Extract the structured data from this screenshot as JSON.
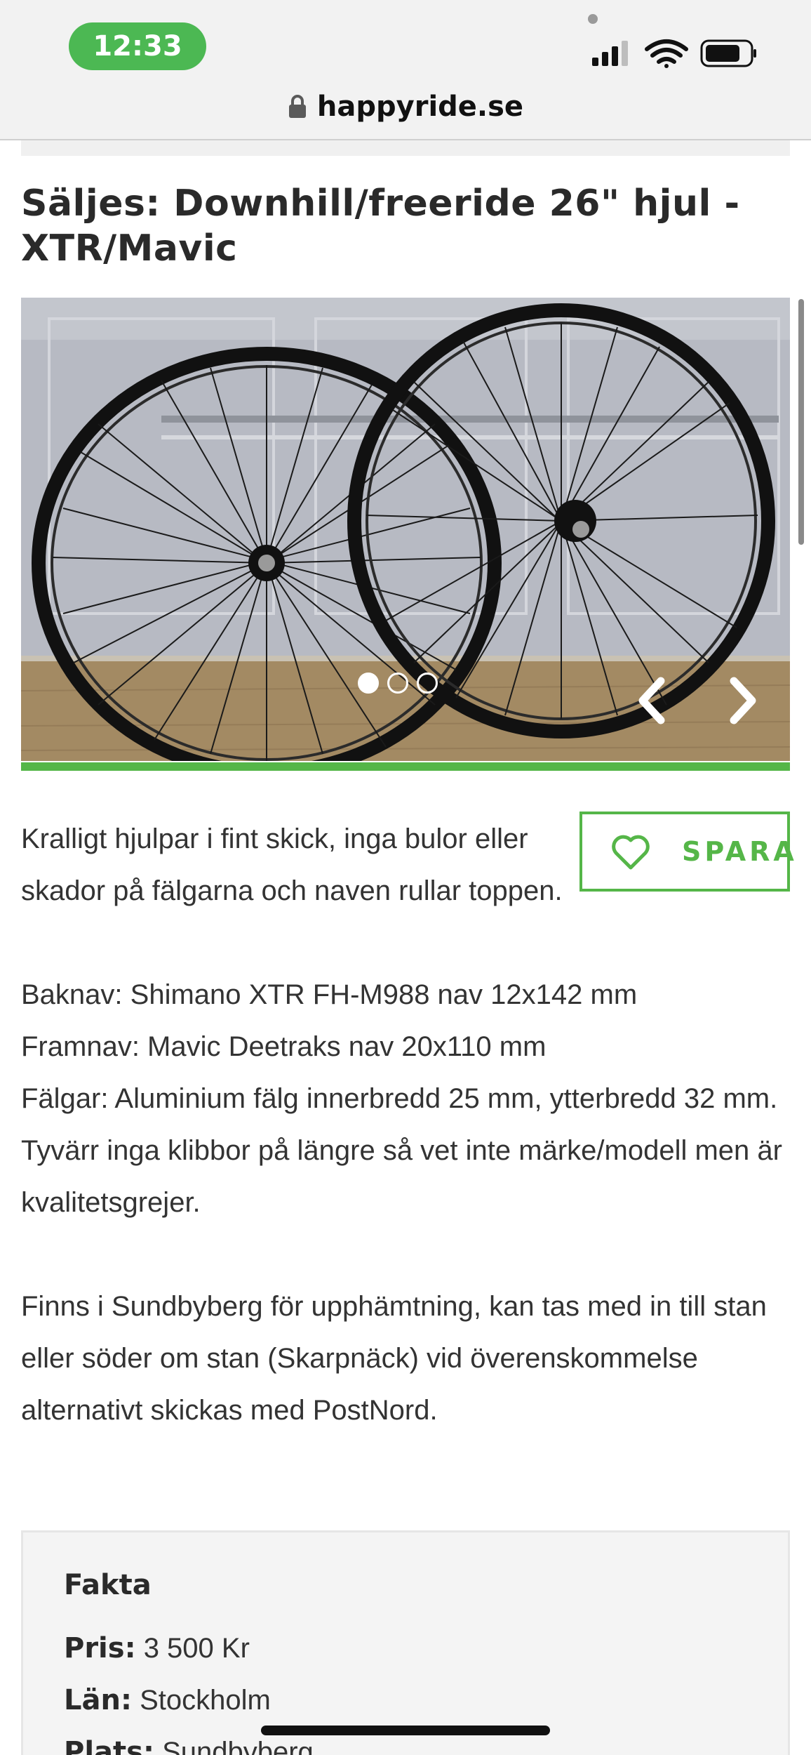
{
  "status_bar": {
    "time": "12:33",
    "icons": [
      "signal-icon",
      "wifi-icon",
      "battery-icon"
    ]
  },
  "browser": {
    "url": "happyride.se",
    "lock_icon": "lock-icon"
  },
  "listing": {
    "title": "Säljes: Downhill/freeride 26\" hjul - XTR/Mavic",
    "gallery": {
      "image_description_icon": "bicycle-wheels-photo",
      "total_images": 3,
      "active_index": 0
    },
    "save_button": {
      "label": "SPARA",
      "icon": "heart-icon",
      "accent": "#55b648"
    },
    "description": {
      "p1": "Kralligt hjulpar i fint skick, inga bulor eller skador på fälgarna och naven rullar toppen.",
      "p2_line1": "Baknav: Shimano XTR FH-M988 nav 12x142 mm",
      "p2_line2": "Framnav: Mavic Deetraks nav 20x110 mm",
      "p2_line3": "Fälgar: Aluminium fälg innerbredd 25 mm, ytterbredd 32 mm. Tyvärr inga klibbor på längre så vet inte märke/modell men är kvalitetsgrejer.",
      "p3": "Finns i Sundbyberg för upphämtning, kan tas med in till stan eller söder om stan (Skarpnäck) vid överenskommelse alternativt skickas med PostNord."
    },
    "facts": {
      "title": "Fakta",
      "price_label": "Pris:",
      "price_value": "3 500 Kr",
      "county_label": "Län:",
      "county_value": "Stockholm",
      "place_label": "Plats:",
      "place_value": "Sundbyberg"
    }
  }
}
